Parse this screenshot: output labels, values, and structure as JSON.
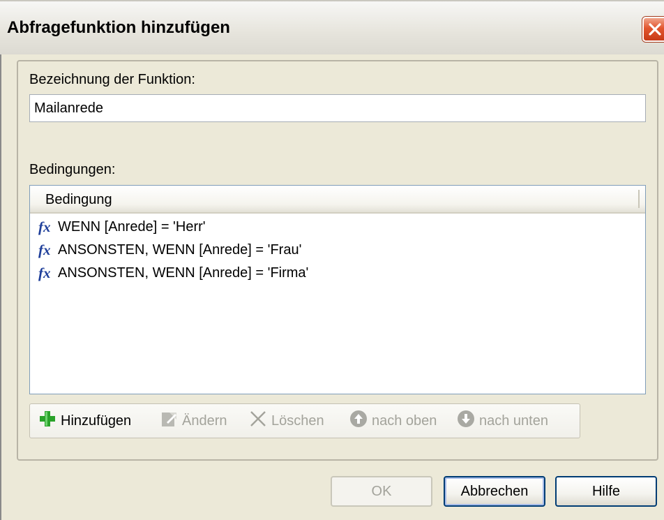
{
  "window": {
    "title": "Abfragefunktion hinzufügen"
  },
  "form": {
    "name_label": "Bezeichnung der Funktion:",
    "name_value": "Mailanrede",
    "conditions_label": "Bedingungen:"
  },
  "list": {
    "column_header": "Bedingung",
    "rows": [
      {
        "icon": "fx-icon",
        "text": "WENN [Anrede] = 'Herr'"
      },
      {
        "icon": "fx-icon",
        "text": "ANSONSTEN, WENN [Anrede] = 'Frau'"
      },
      {
        "icon": "fx-icon",
        "text": "ANSONSTEN, WENN [Anrede] = 'Firma'"
      }
    ]
  },
  "toolbar": {
    "add": "Hinzufügen",
    "edit": "Ändern",
    "delete": "Löschen",
    "up": "nach oben",
    "down": "nach unten"
  },
  "buttons": {
    "ok": "OK",
    "cancel": "Abbrechen",
    "help": "Hilfe"
  },
  "colors": {
    "title_bar": "#e6e4dc",
    "dialog_bg": "#ece9d8",
    "close_red": "#e2552e",
    "fx_blue": "#1f3f9a",
    "add_green": "#2aa32a",
    "disabled_text": "#a3a39b"
  }
}
